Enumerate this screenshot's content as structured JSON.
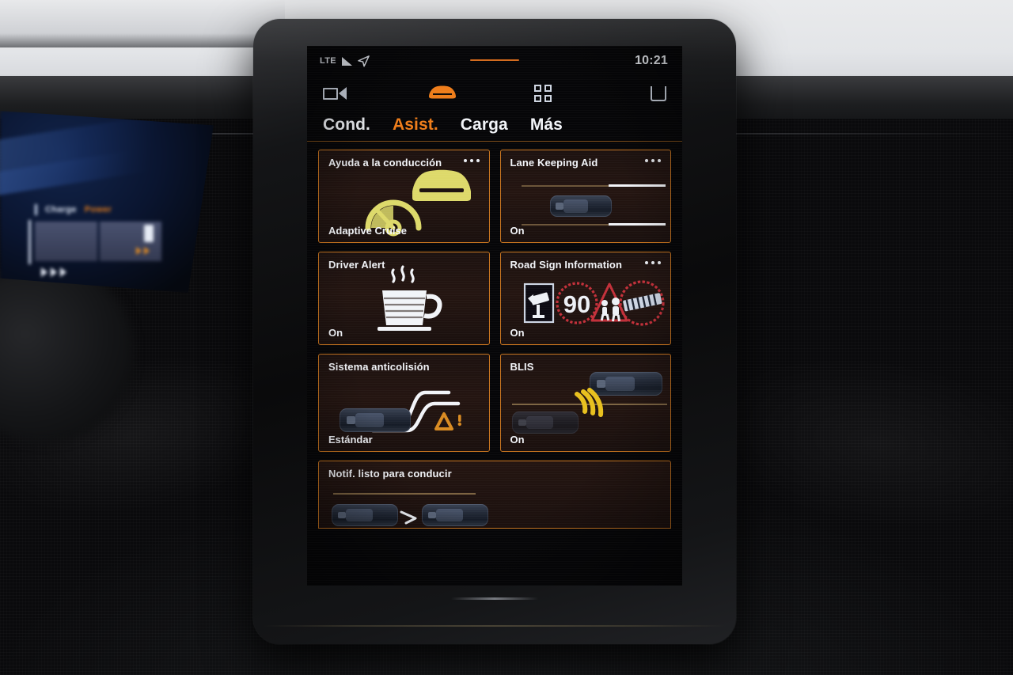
{
  "status_bar": {
    "network_label": "LTE",
    "signal_icon": "signal-bars-icon",
    "location_icon": "navigation-arrow-icon",
    "time": "10:21",
    "handle_color": "#d2691b"
  },
  "icon_bar": {
    "items": [
      {
        "name": "camera-icon",
        "label": "Camera"
      },
      {
        "name": "car-icon",
        "label": "Vehicle",
        "active": true,
        "color": "#ef7d1a"
      },
      {
        "name": "apps-grid-icon",
        "label": "Apps"
      },
      {
        "name": "parking-icon",
        "label": "Parking"
      }
    ]
  },
  "tabs": [
    {
      "label": "Cond.",
      "active": false
    },
    {
      "label": "Asist.",
      "active": true
    },
    {
      "label": "Carga",
      "active": false
    },
    {
      "label": "Más",
      "active": false
    }
  ],
  "theme": {
    "accent": "#ef7d1a",
    "card_border": "#c9751f",
    "card_bg": "#241511",
    "text": "#f3f5f9",
    "yellow": "#ddd96a",
    "blis_yellow": "#e8c01e",
    "sign_red": "#c3303a"
  },
  "cards": [
    {
      "title": "Ayuda a la conducción",
      "status": "Adaptive Cruise",
      "has_menu": true,
      "menu_icon": "more-options-icon",
      "art": "cruise-car-speedometer-icon"
    },
    {
      "title": "Lane Keeping Aid",
      "status": "On",
      "has_menu": true,
      "menu_icon": "more-options-icon",
      "art": "lane-keeping-car-icon"
    },
    {
      "title": "Driver Alert",
      "status": "On",
      "has_menu": false,
      "art": "coffee-cup-icon"
    },
    {
      "title": "Road Sign Information",
      "status": "On",
      "has_menu": true,
      "menu_icon": "more-options-icon",
      "art": "road-signs-icon",
      "signs": {
        "camera_sign": "speed-camera-icon",
        "speed_limit": "90",
        "pedestrian_sign": "pedestrian-crossing-icon",
        "no_overtaking_sign": "no-overtaking-icon"
      }
    },
    {
      "title": "Sistema anticolisión",
      "status": "Estándar",
      "has_menu": false,
      "art": "collision-avoidance-icon"
    },
    {
      "title": "BLIS",
      "status": "On",
      "has_menu": false,
      "art": "blind-spot-cars-icon"
    }
  ],
  "bottom_card": {
    "title": "Notif. listo para conducir",
    "art": "ready-to-drive-cars-icon"
  },
  "instrument_cluster": {
    "charge_label": "Charge",
    "power_label": "Power",
    "power_color": "#e07a1c"
  }
}
